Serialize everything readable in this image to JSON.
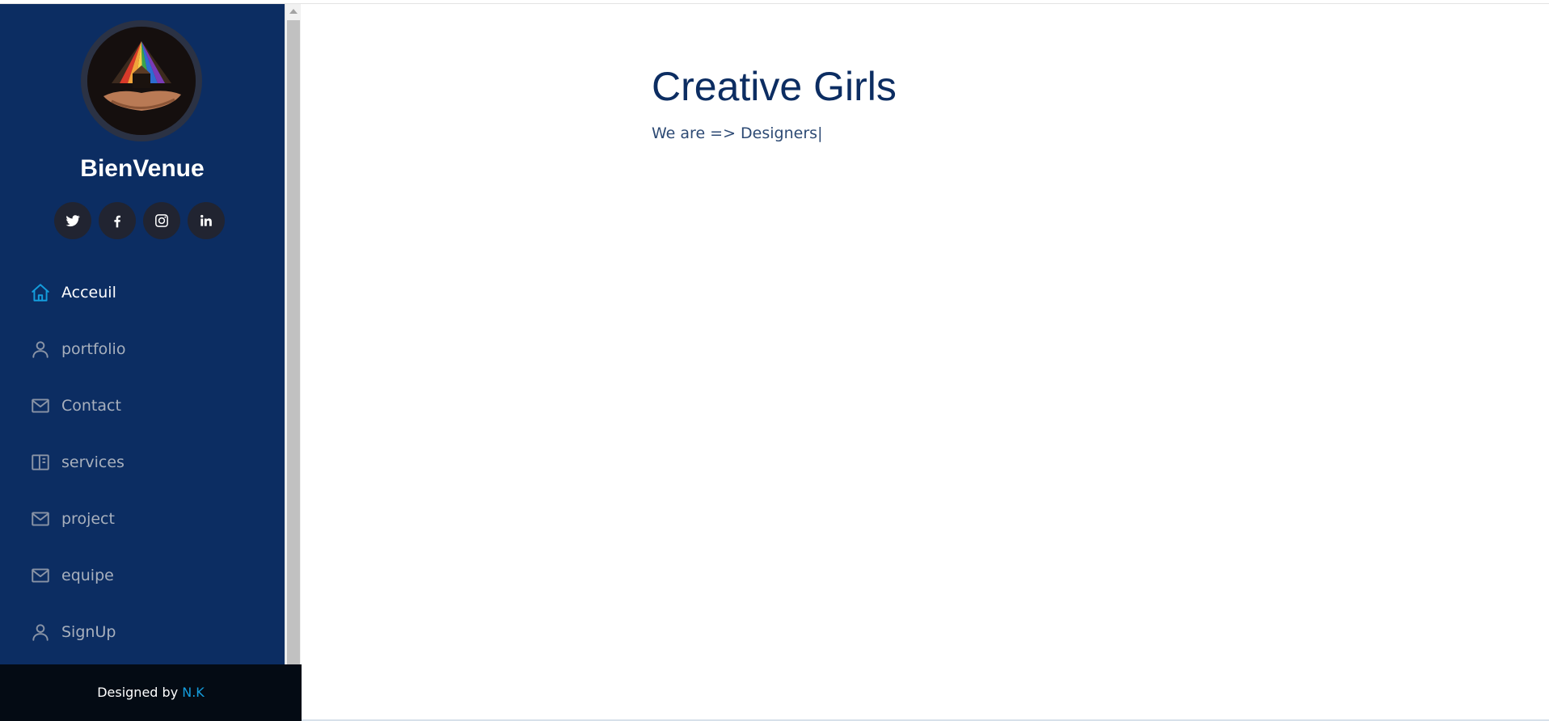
{
  "sidebar": {
    "brand": "BienVenue",
    "social": [
      {
        "name": "twitter-icon"
      },
      {
        "name": "facebook-icon"
      },
      {
        "name": "instagram-icon"
      },
      {
        "name": "linkedin-icon"
      }
    ],
    "nav": [
      {
        "label": "Acceuil",
        "icon": "home-icon",
        "active": true
      },
      {
        "label": "portfolio",
        "icon": "user-icon",
        "active": false
      },
      {
        "label": "Contact",
        "icon": "envelope-icon",
        "active": false
      },
      {
        "label": "services",
        "icon": "layout-icon",
        "active": false
      },
      {
        "label": "project",
        "icon": "envelope-icon",
        "active": false
      },
      {
        "label": "equipe",
        "icon": "envelope-icon",
        "active": false
      },
      {
        "label": "SignUp",
        "icon": "user-icon",
        "active": false
      }
    ]
  },
  "footer": {
    "text": "Designed by ",
    "link": "N.K"
  },
  "hero": {
    "title": "Creative Girls",
    "subtitle": "We are => Designers",
    "cursor": "|"
  },
  "colors": {
    "sidebar_bg": "#0c2d62",
    "accent": "#149ddd",
    "footer_bg": "#040b14",
    "title": "#0c2d62"
  }
}
